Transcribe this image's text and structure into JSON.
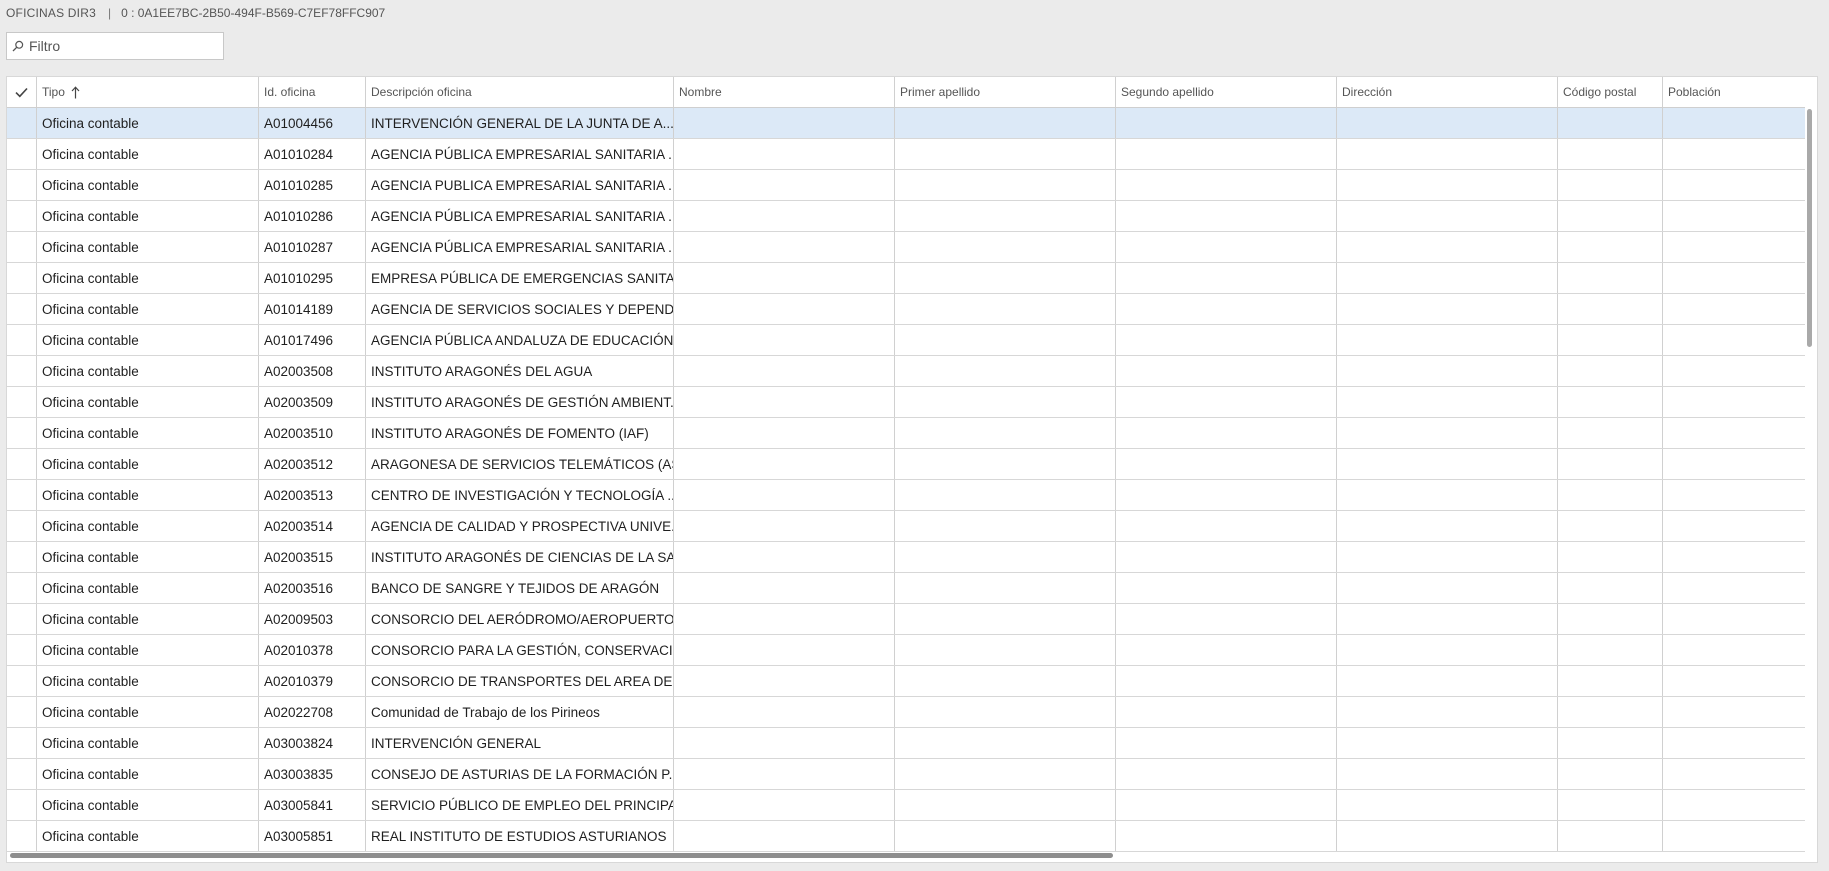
{
  "header": {
    "title": "OFICINAS DIR3",
    "separator": "|",
    "record_id": "0 : 0A1EE7BC-2B50-494F-B569-C7EF78FFC907"
  },
  "filter": {
    "placeholder": "Filtro",
    "value": ""
  },
  "columns": [
    "Tipo",
    "Id. oficina",
    "Descripción oficina",
    "Nombre",
    "Primer apellido",
    "Segundo apellido",
    "Dirección",
    "Código postal",
    "Población"
  ],
  "sort": {
    "column": "Tipo",
    "direction": "ascending"
  },
  "selected_row": 0,
  "rows": [
    [
      "Oficina contable",
      "A01004456",
      "INTERVENCIÓN GENERAL DE LA JUNTA DE A..."
    ],
    [
      "Oficina contable",
      "A01010284",
      "AGENCIA PÚBLICA EMPRESARIAL SANITARIA ..."
    ],
    [
      "Oficina contable",
      "A01010285",
      "AGENCIA PUBLICA EMPRESARIAL SANITARIA ..."
    ],
    [
      "Oficina contable",
      "A01010286",
      "AGENCIA PÚBLICA EMPRESARIAL SANITARIA ..."
    ],
    [
      "Oficina contable",
      "A01010287",
      "AGENCIA PÚBLICA EMPRESARIAL SANITARIA ..."
    ],
    [
      "Oficina contable",
      "A01010295",
      "EMPRESA PÚBLICA DE EMERGENCIAS SANITA..."
    ],
    [
      "Oficina contable",
      "A01014189",
      "AGENCIA DE SERVICIOS SOCIALES Y DEPENDE..."
    ],
    [
      "Oficina contable",
      "A01017496",
      "AGENCIA PÚBLICA ANDALUZA DE EDUCACIÓN"
    ],
    [
      "Oficina contable",
      "A02003508",
      "INSTITUTO ARAGONÉS DEL AGUA"
    ],
    [
      "Oficina contable",
      "A02003509",
      "INSTITUTO ARAGONÉS DE GESTIÓN AMBIENT..."
    ],
    [
      "Oficina contable",
      "A02003510",
      "INSTITUTO ARAGONÉS DE FOMENTO (IAF)"
    ],
    [
      "Oficina contable",
      "A02003512",
      "ARAGONESA DE SERVICIOS TELEMÁTICOS (AST)"
    ],
    [
      "Oficina contable",
      "A02003513",
      "CENTRO DE INVESTIGACIÓN Y TECNOLOGÍA ..."
    ],
    [
      "Oficina contable",
      "A02003514",
      "AGENCIA DE CALIDAD Y PROSPECTIVA UNIVE..."
    ],
    [
      "Oficina contable",
      "A02003515",
      "INSTITUTO ARAGONÉS DE CIENCIAS DE LA SA..."
    ],
    [
      "Oficina contable",
      "A02003516",
      "BANCO DE SANGRE Y TEJIDOS DE ARAGÓN"
    ],
    [
      "Oficina contable",
      "A02009503",
      "CONSORCIO DEL AERÓDROMO/AEROPUERTO..."
    ],
    [
      "Oficina contable",
      "A02010378",
      "CONSORCIO PARA LA GESTIÓN, CONSERVACI..."
    ],
    [
      "Oficina contable",
      "A02010379",
      "CONSORCIO DE TRANSPORTES DEL AREA DE ..."
    ],
    [
      "Oficina contable",
      "A02022708",
      "Comunidad de Trabajo de los Pirineos"
    ],
    [
      "Oficina contable",
      "A03003824",
      "INTERVENCIÓN GENERAL"
    ],
    [
      "Oficina contable",
      "A03003835",
      "CONSEJO DE ASTURIAS DE LA FORMACIÓN P..."
    ],
    [
      "Oficina contable",
      "A03005841",
      "SERVICIO PÚBLICO DE EMPLEO DEL PRINCIPA..."
    ],
    [
      "Oficina contable",
      "A03005851",
      "REAL INSTITUTO DE ESTUDIOS ASTURIANOS"
    ]
  ],
  "icons": {
    "select_all": "checkmark-icon",
    "filter": "search-icon",
    "sort": "sort-ascending-arrow-icon"
  }
}
